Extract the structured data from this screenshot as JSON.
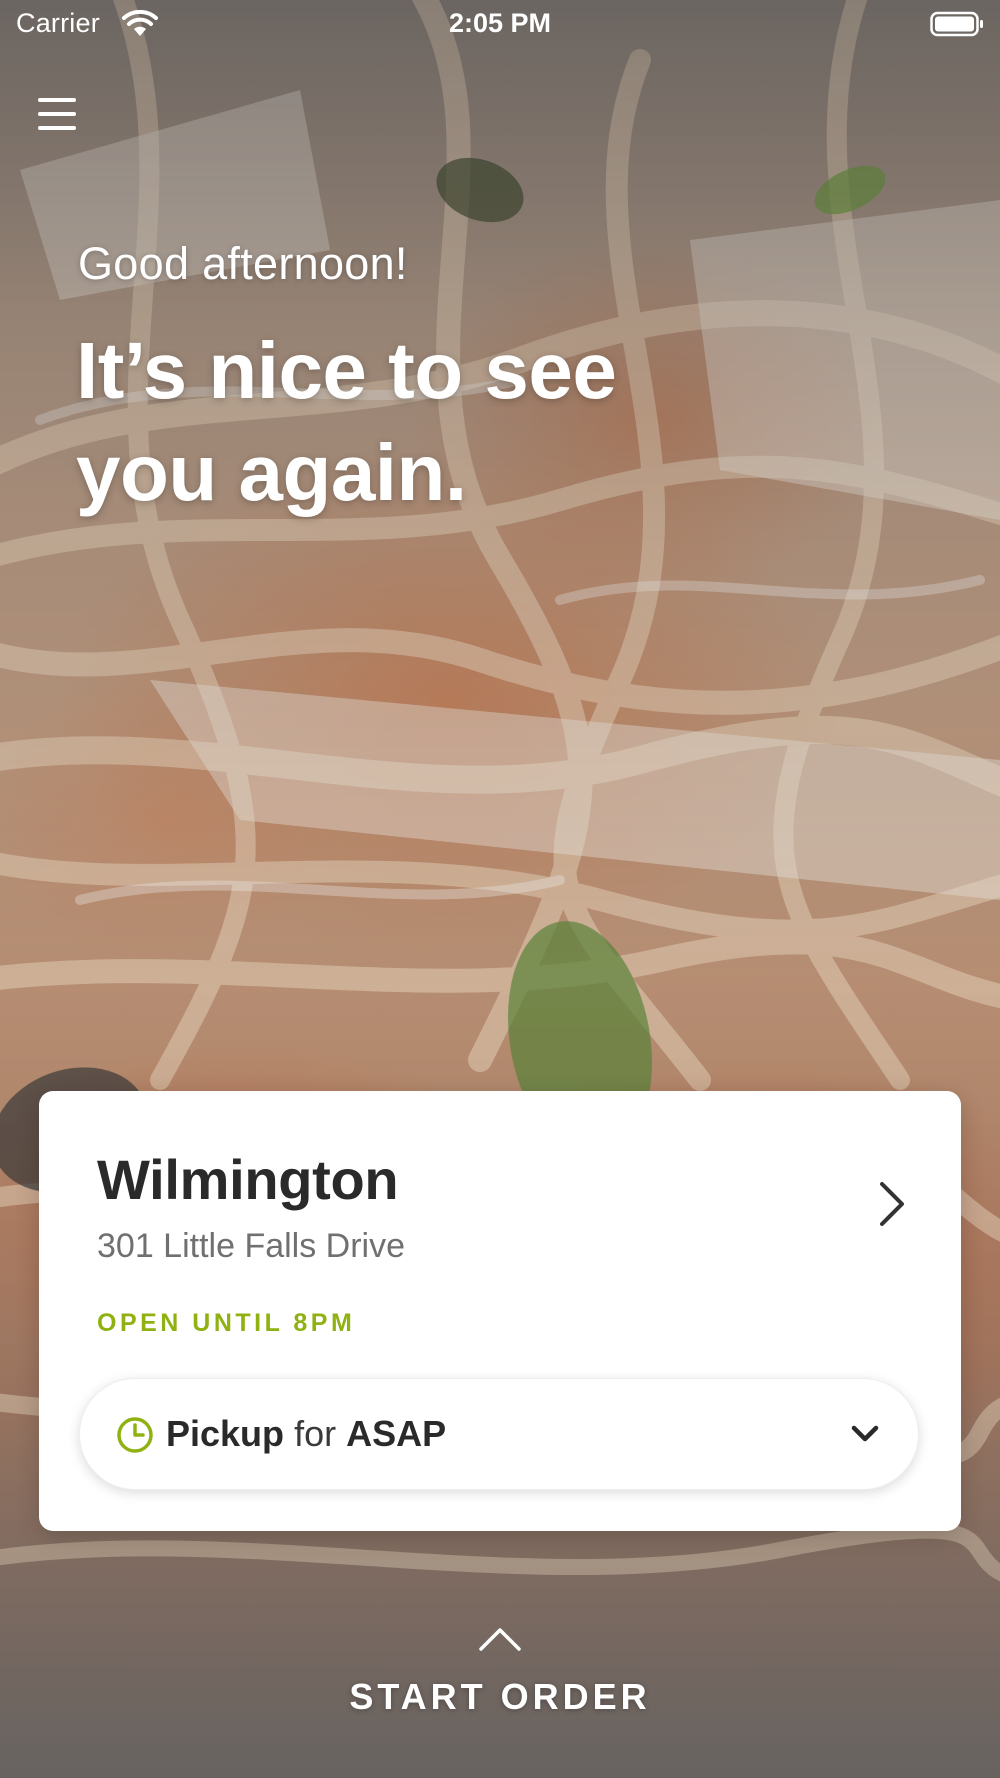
{
  "status_bar": {
    "carrier": "Carrier",
    "time": "2:05 PM",
    "wifi_icon": "wifi-icon",
    "battery_icon": "battery-icon"
  },
  "menu": {
    "icon": "hamburger-menu-icon"
  },
  "hero": {
    "greeting": "Good afternoon!",
    "headline_line1": "It’s nice to see",
    "headline_line2": "you again."
  },
  "location_card": {
    "name": "Wilmington",
    "address": "301 Little Falls Drive",
    "hours": "OPEN UNTIL 8PM",
    "chevron_icon": "chevron-right-icon"
  },
  "order_mode": {
    "icon": "clock-icon",
    "mode": "Pickup",
    "connector": "for",
    "time": "ASAP",
    "dropdown_icon": "chevron-down-icon"
  },
  "start_order": {
    "icon": "chevron-up-icon",
    "label": "START ORDER"
  },
  "colors": {
    "accent_green": "#8fb212",
    "card_background": "#ffffff",
    "text_dark": "#2a2a2a",
    "text_muted": "#707070"
  }
}
